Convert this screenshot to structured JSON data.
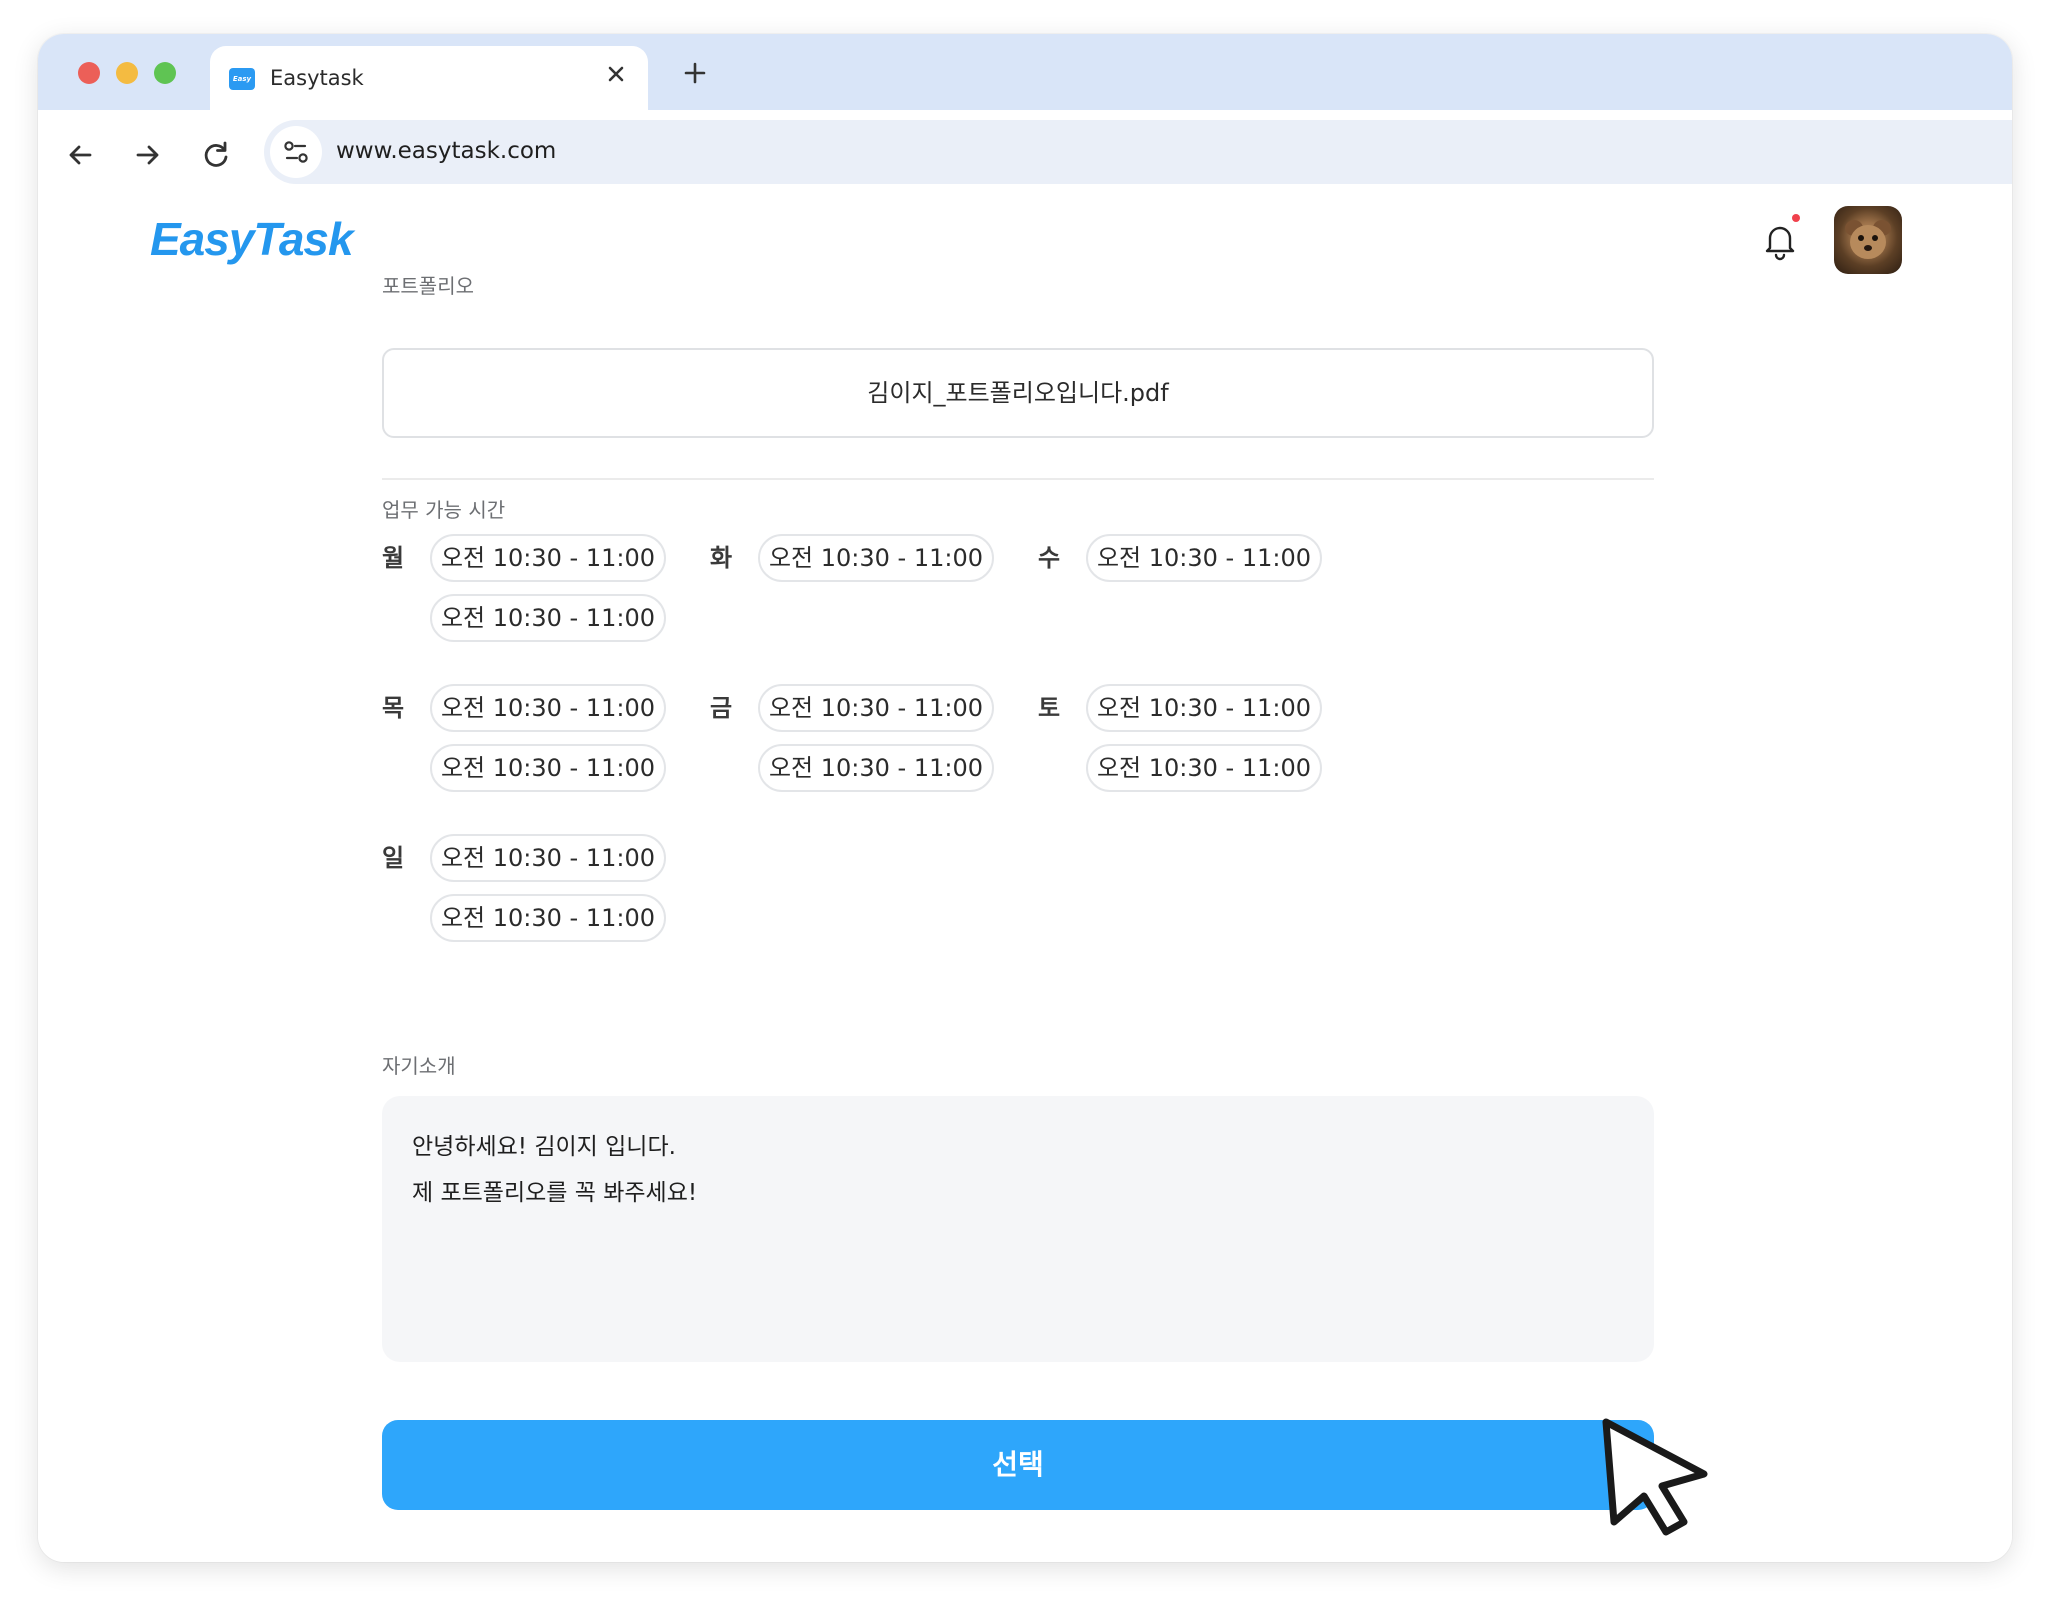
{
  "browser": {
    "tab_title": "Easytask",
    "favicon_text": "Easy",
    "url": "www.easytask.com"
  },
  "header": {
    "logo": "EasyTask"
  },
  "portfolio": {
    "label": "포트폴리오",
    "filename": "김이지_포트폴리오입니다.pdf"
  },
  "availability": {
    "label": "업무 가능 시간",
    "days": [
      {
        "day": "월",
        "slots": [
          "오전 10:30 - 11:00",
          "오전 10:30 - 11:00"
        ]
      },
      {
        "day": "화",
        "slots": [
          "오전 10:30 - 11:00"
        ]
      },
      {
        "day": "수",
        "slots": [
          "오전 10:30 - 11:00"
        ]
      },
      {
        "day": "목",
        "slots": [
          "오전 10:30 - 11:00",
          "오전 10:30 - 11:00"
        ]
      },
      {
        "day": "금",
        "slots": [
          "오전 10:30 - 11:00",
          "오전 10:30 - 11:00"
        ]
      },
      {
        "day": "토",
        "slots": [
          "오전 10:30 - 11:00",
          "오전 10:30 - 11:00"
        ]
      },
      {
        "day": "일",
        "slots": [
          "오전 10:30 - 11:00",
          "오전 10:30 - 11:00"
        ]
      }
    ]
  },
  "intro": {
    "label": "자기소개",
    "lines": [
      "안녕하세요! 김이지 입니다.",
      "제 포트폴리오를 꼭 봐주세요!"
    ]
  },
  "actions": {
    "select_label": "선택"
  },
  "colors": {
    "brand": "#2497ee",
    "button": "#2ea6fb",
    "notification_dot": "#f0414c"
  }
}
